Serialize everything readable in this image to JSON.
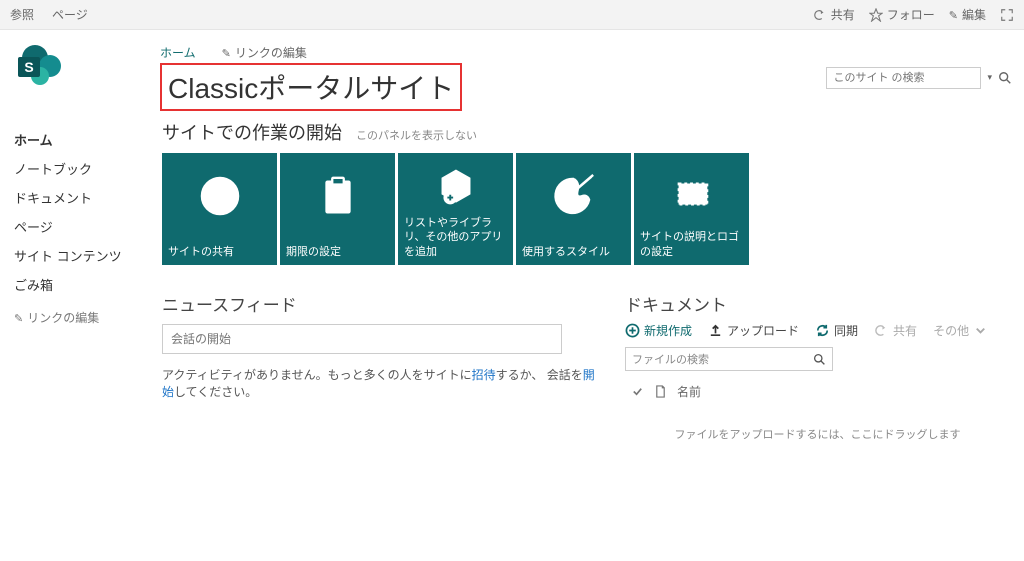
{
  "ribbon": {
    "browse": "参照",
    "page": "ページ",
    "share": "共有",
    "follow": "フォロー",
    "edit": "編集"
  },
  "breadcrumb": {
    "home": "ホーム",
    "editLinks": "リンクの編集"
  },
  "siteTitle": "Classicポータルサイト",
  "search": {
    "placeholder": "このサイト の検索"
  },
  "sidebar": {
    "items": [
      "ホーム",
      "ノートブック",
      "ドキュメント",
      "ページ",
      "サイト コンテンツ",
      "ごみ箱"
    ],
    "editLinks": "リンクの編集"
  },
  "getStarted": {
    "title": "サイトでの作業の開始",
    "hide": "このパネルを表示しない",
    "tiles": [
      "サイトの共有",
      "期限の設定",
      "リストやライブラリ、その他のアプリを追加",
      "使用するスタイル",
      "サイトの説明とロゴの設定"
    ]
  },
  "newsfeed": {
    "title": "ニュースフィード",
    "placeholder": "会話の開始",
    "empty_pre": "アクティビティがありません。もっと多くの人をサイトに",
    "invite": "招待",
    "empty_mid": "するか、 会話を",
    "start": "開始",
    "empty_post": "してください。"
  },
  "documents": {
    "title": "ドキュメント",
    "new": "新規作成",
    "upload": "アップロード",
    "sync": "同期",
    "share": "共有",
    "more": "その他",
    "searchPlaceholder": "ファイルの検索",
    "colName": "名前",
    "dropzone": "ファイルをアップロードするには、ここにドラッグします"
  }
}
